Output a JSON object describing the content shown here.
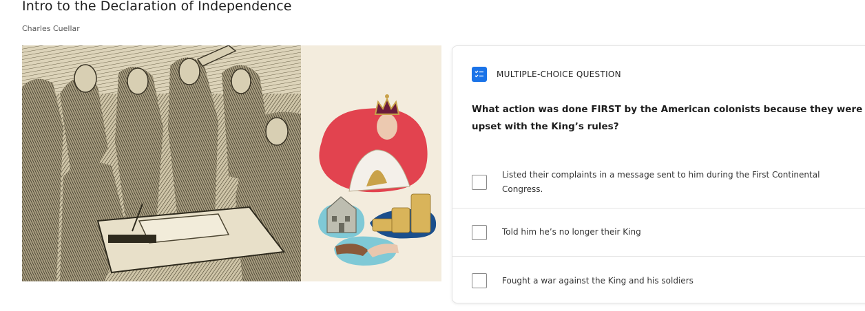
{
  "lesson": {
    "title": "Intro to the Declaration of Independence",
    "author": "Charles Cuellar"
  },
  "hero_image": {
    "left": "engraving-signing-scene",
    "right": "collage-king-house-coins-handshake"
  },
  "question": {
    "type_icon": "checklist-icon",
    "type_label": "MULTIPLE-CHOICE QUESTION",
    "text": "What action was done FIRST by the American colonists because they were upset with the King’s rules?",
    "answers": [
      {
        "label": "Listed their complaints in a message sent to him during the First Continental Congress.",
        "checked": false
      },
      {
        "label": "Told him he’s no longer their King",
        "checked": false
      },
      {
        "label": "Fought a war against the King and his soldiers",
        "checked": false
      }
    ]
  },
  "colors": {
    "accent": "#1a73e8",
    "collage_red": "#e2434f",
    "collage_teal": "#7fc9d6",
    "collage_navy": "#1b4f8c"
  }
}
